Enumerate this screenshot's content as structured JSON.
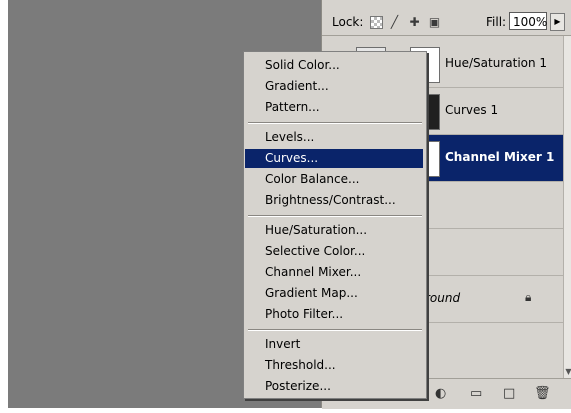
{
  "layers_panel": {
    "lock_label": "Lock:",
    "fill_label": "Fill:",
    "fill_value": "100%",
    "layers": [
      {
        "name": "Hue/Saturation 1",
        "selected": false
      },
      {
        "name": "Curves 1",
        "selected": false
      },
      {
        "name": "Channel Mixer 1",
        "selected": true
      },
      {
        "name": "round",
        "selected": false
      }
    ]
  },
  "adjustment_menu": {
    "items": [
      {
        "label": "Solid Color...",
        "highlighted": false
      },
      {
        "label": "Gradient...",
        "highlighted": false
      },
      {
        "label": "Pattern...",
        "highlighted": false
      },
      {
        "label": "Levels...",
        "highlighted": false
      },
      {
        "label": "Curves...",
        "highlighted": true
      },
      {
        "label": "Color Balance...",
        "highlighted": false
      },
      {
        "label": "Brightness/Contrast...",
        "highlighted": false
      },
      {
        "label": "Hue/Saturation...",
        "highlighted": false
      },
      {
        "label": "Selective Color...",
        "highlighted": false
      },
      {
        "label": "Channel Mixer...",
        "highlighted": false
      },
      {
        "label": "Gradient Map...",
        "highlighted": false
      },
      {
        "label": "Photo Filter...",
        "highlighted": false
      },
      {
        "label": "Invert",
        "highlighted": false
      },
      {
        "label": "Threshold...",
        "highlighted": false
      },
      {
        "label": "Posterize...",
        "highlighted": false
      }
    ]
  },
  "icons": {
    "lock_transparent": "checkerboard-lock-icon",
    "lock_image": "brush-lock-icon",
    "lock_position": "move-lock-icon",
    "lock_all": "padlock-icon",
    "bottom": [
      "adjustment-layer-icon",
      "new-group-icon",
      "new-layer-icon",
      "trash-icon"
    ]
  },
  "colors": {
    "selection": "#0a246a",
    "panel": "#d6d3ce",
    "workspace": "#7b7b7b"
  }
}
